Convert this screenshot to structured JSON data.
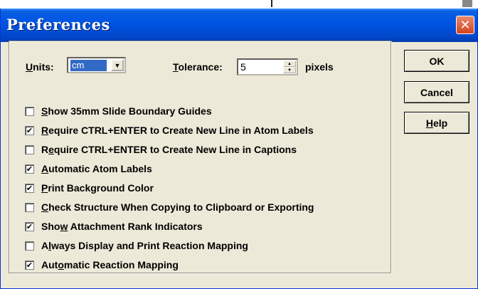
{
  "dialog": {
    "title": "Preferences",
    "close_glyph": "✕"
  },
  "units": {
    "label_mnemonic": "U",
    "label_rest": "nits:",
    "value": "cm",
    "arrow_glyph": "▼"
  },
  "tolerance": {
    "label_mnemonic": "T",
    "label_rest": "olerance:",
    "value": "5",
    "suffix": "pixels",
    "up_glyph": "▲",
    "down_glyph": "▼"
  },
  "options": [
    {
      "pre": "",
      "mnemonic": "S",
      "post": "how 35mm Slide Boundary Guides",
      "checked": false,
      "mark": ""
    },
    {
      "pre": "",
      "mnemonic": "R",
      "post": "equire CTRL+ENTER to Create New Line in Atom Labels",
      "checked": true,
      "mark": "✔"
    },
    {
      "pre": "R",
      "mnemonic": "e",
      "post": "quire CTRL+ENTER to Create New Line in Captions",
      "checked": false,
      "mark": ""
    },
    {
      "pre": "",
      "mnemonic": "A",
      "post": "utomatic Atom Labels",
      "checked": true,
      "mark": "✔"
    },
    {
      "pre": "",
      "mnemonic": "P",
      "post": "rint Background Color",
      "checked": true,
      "mark": "✔"
    },
    {
      "pre": "",
      "mnemonic": "C",
      "post": "heck Structure When Copying to Clipboard or Exporting",
      "checked": false,
      "mark": ""
    },
    {
      "pre": "Sho",
      "mnemonic": "w",
      "post": " Attachment Rank Indicators",
      "checked": true,
      "mark": "✔"
    },
    {
      "pre": "A",
      "mnemonic": "l",
      "post": "ways Display and Print Reaction Mapping",
      "checked": false,
      "mark": ""
    },
    {
      "pre": "Aut",
      "mnemonic": "o",
      "post": "matic Reaction Mapping",
      "checked": true,
      "mark": "✔"
    }
  ],
  "buttons": {
    "ok": "OK",
    "cancel": "Cancel",
    "help_mnemonic": "H",
    "help_rest": "elp"
  },
  "colors": {
    "titlebar": "#0055e5",
    "dialog_bg": "#ece9d8",
    "selection": "#316ac5",
    "close": "#d4441e"
  }
}
